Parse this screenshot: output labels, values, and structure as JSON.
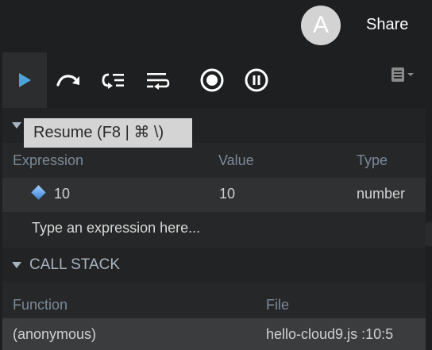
{
  "header": {
    "avatar_letter": "A",
    "share_label": "Share"
  },
  "toolbar": {
    "buttons": [
      "resume",
      "step-over",
      "step-into",
      "step-out",
      "deactivate-breakpoints",
      "pause-on-exceptions"
    ],
    "active": "resume"
  },
  "tooltip": {
    "text": "Resume (F8 | ⌘ \\)"
  },
  "watch": {
    "columns": {
      "expression": "Expression",
      "value": "Value",
      "type": "Type"
    },
    "rows": [
      {
        "expression": "10",
        "value": "10",
        "type": "number"
      }
    ],
    "placeholder": "Type an expression here..."
  },
  "call_stack": {
    "title": "CALL STACK",
    "columns": {
      "function": "Function",
      "file": "File"
    },
    "rows": [
      {
        "function": "(anonymous)",
        "file": "hello-cloud9.js :10:5"
      }
    ]
  },
  "colors": {
    "accent": "#4aa3df",
    "background": "#1e1f20",
    "panel": "#262728"
  }
}
